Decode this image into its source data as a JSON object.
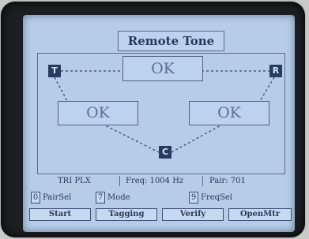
{
  "screen": {
    "title": "Remote Tone"
  },
  "diagram": {
    "nodes": {
      "left": "T",
      "right": "R",
      "bottom": "C"
    },
    "status": {
      "top": "OK",
      "left": "OK",
      "right": "OK"
    }
  },
  "statusbar": {
    "mode": "TRI PLX",
    "freq": "Freq: 1004 Hz",
    "pair": "Pair:     701"
  },
  "options": [
    {
      "key": "0",
      "label": "PairSel"
    },
    {
      "key": "7",
      "label": "Mode"
    },
    {
      "key": "9",
      "label": "FreqSel"
    }
  ],
  "softkeys": [
    "Start",
    "Tagging",
    "Verify",
    "OpenMtr"
  ]
}
